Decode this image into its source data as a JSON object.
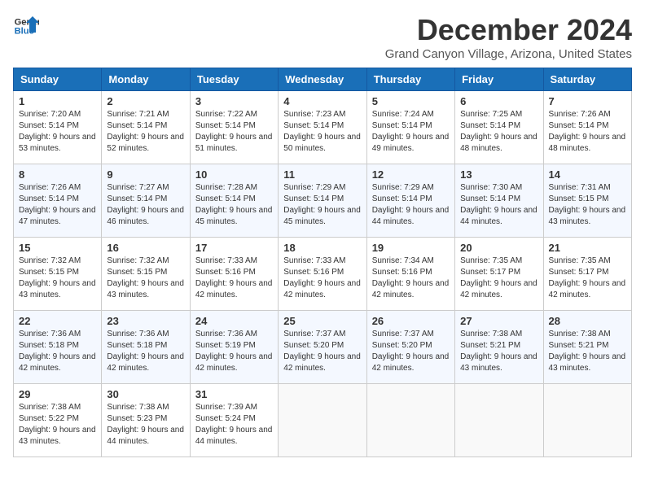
{
  "logo": {
    "line1": "General",
    "line2": "Blue"
  },
  "title": "December 2024",
  "subtitle": "Grand Canyon Village, Arizona, United States",
  "headers": [
    "Sunday",
    "Monday",
    "Tuesday",
    "Wednesday",
    "Thursday",
    "Friday",
    "Saturday"
  ],
  "weeks": [
    [
      {
        "day": "1",
        "sunrise": "7:20 AM",
        "sunset": "5:14 PM",
        "daylight": "9 hours and 53 minutes."
      },
      {
        "day": "2",
        "sunrise": "7:21 AM",
        "sunset": "5:14 PM",
        "daylight": "9 hours and 52 minutes."
      },
      {
        "day": "3",
        "sunrise": "7:22 AM",
        "sunset": "5:14 PM",
        "daylight": "9 hours and 51 minutes."
      },
      {
        "day": "4",
        "sunrise": "7:23 AM",
        "sunset": "5:14 PM",
        "daylight": "9 hours and 50 minutes."
      },
      {
        "day": "5",
        "sunrise": "7:24 AM",
        "sunset": "5:14 PM",
        "daylight": "9 hours and 49 minutes."
      },
      {
        "day": "6",
        "sunrise": "7:25 AM",
        "sunset": "5:14 PM",
        "daylight": "9 hours and 48 minutes."
      },
      {
        "day": "7",
        "sunrise": "7:26 AM",
        "sunset": "5:14 PM",
        "daylight": "9 hours and 48 minutes."
      }
    ],
    [
      {
        "day": "8",
        "sunrise": "7:26 AM",
        "sunset": "5:14 PM",
        "daylight": "9 hours and 47 minutes."
      },
      {
        "day": "9",
        "sunrise": "7:27 AM",
        "sunset": "5:14 PM",
        "daylight": "9 hours and 46 minutes."
      },
      {
        "day": "10",
        "sunrise": "7:28 AM",
        "sunset": "5:14 PM",
        "daylight": "9 hours and 45 minutes."
      },
      {
        "day": "11",
        "sunrise": "7:29 AM",
        "sunset": "5:14 PM",
        "daylight": "9 hours and 45 minutes."
      },
      {
        "day": "12",
        "sunrise": "7:29 AM",
        "sunset": "5:14 PM",
        "daylight": "9 hours and 44 minutes."
      },
      {
        "day": "13",
        "sunrise": "7:30 AM",
        "sunset": "5:14 PM",
        "daylight": "9 hours and 44 minutes."
      },
      {
        "day": "14",
        "sunrise": "7:31 AM",
        "sunset": "5:15 PM",
        "daylight": "9 hours and 43 minutes."
      }
    ],
    [
      {
        "day": "15",
        "sunrise": "7:32 AM",
        "sunset": "5:15 PM",
        "daylight": "9 hours and 43 minutes."
      },
      {
        "day": "16",
        "sunrise": "7:32 AM",
        "sunset": "5:15 PM",
        "daylight": "9 hours and 43 minutes."
      },
      {
        "day": "17",
        "sunrise": "7:33 AM",
        "sunset": "5:16 PM",
        "daylight": "9 hours and 42 minutes."
      },
      {
        "day": "18",
        "sunrise": "7:33 AM",
        "sunset": "5:16 PM",
        "daylight": "9 hours and 42 minutes."
      },
      {
        "day": "19",
        "sunrise": "7:34 AM",
        "sunset": "5:16 PM",
        "daylight": "9 hours and 42 minutes."
      },
      {
        "day": "20",
        "sunrise": "7:35 AM",
        "sunset": "5:17 PM",
        "daylight": "9 hours and 42 minutes."
      },
      {
        "day": "21",
        "sunrise": "7:35 AM",
        "sunset": "5:17 PM",
        "daylight": "9 hours and 42 minutes."
      }
    ],
    [
      {
        "day": "22",
        "sunrise": "7:36 AM",
        "sunset": "5:18 PM",
        "daylight": "9 hours and 42 minutes."
      },
      {
        "day": "23",
        "sunrise": "7:36 AM",
        "sunset": "5:18 PM",
        "daylight": "9 hours and 42 minutes."
      },
      {
        "day": "24",
        "sunrise": "7:36 AM",
        "sunset": "5:19 PM",
        "daylight": "9 hours and 42 minutes."
      },
      {
        "day": "25",
        "sunrise": "7:37 AM",
        "sunset": "5:20 PM",
        "daylight": "9 hours and 42 minutes."
      },
      {
        "day": "26",
        "sunrise": "7:37 AM",
        "sunset": "5:20 PM",
        "daylight": "9 hours and 42 minutes."
      },
      {
        "day": "27",
        "sunrise": "7:38 AM",
        "sunset": "5:21 PM",
        "daylight": "9 hours and 43 minutes."
      },
      {
        "day": "28",
        "sunrise": "7:38 AM",
        "sunset": "5:21 PM",
        "daylight": "9 hours and 43 minutes."
      }
    ],
    [
      {
        "day": "29",
        "sunrise": "7:38 AM",
        "sunset": "5:22 PM",
        "daylight": "9 hours and 43 minutes."
      },
      {
        "day": "30",
        "sunrise": "7:38 AM",
        "sunset": "5:23 PM",
        "daylight": "9 hours and 44 minutes."
      },
      {
        "day": "31",
        "sunrise": "7:39 AM",
        "sunset": "5:24 PM",
        "daylight": "9 hours and 44 minutes."
      },
      null,
      null,
      null,
      null
    ]
  ]
}
